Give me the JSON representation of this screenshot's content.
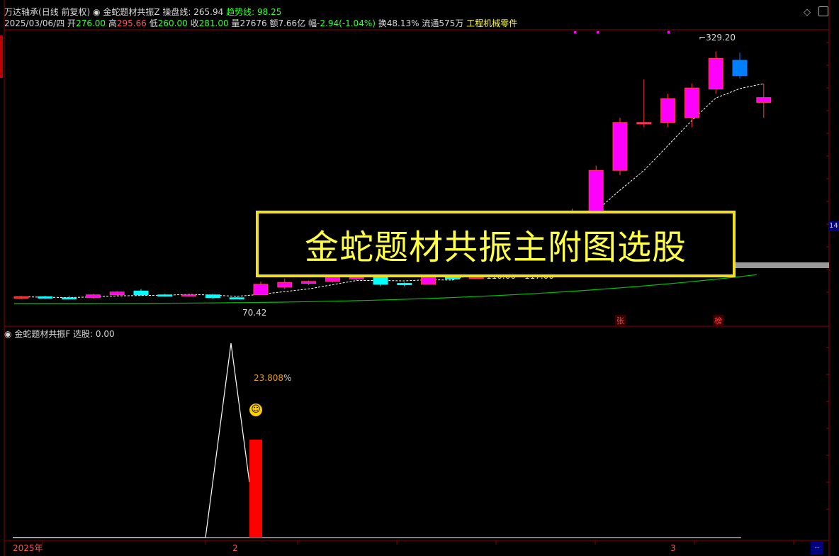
{
  "header": {
    "stock_name": "万达轴承",
    "period": "(日线 前复权)",
    "indicator_name": "金蛇题材共振Z",
    "line1_label": "操盘线:",
    "line1_value": "265.94",
    "line2_label": "趋势线:",
    "line2_value": "98.25"
  },
  "quote": {
    "date": "2025/03/06/四",
    "open_label": "开",
    "open": "276.00",
    "high_label": "高",
    "high": "295.66",
    "low_label": "低",
    "low": "260.00",
    "close_label": "收",
    "close": "281.00",
    "volume_label": "量",
    "volume": "27676",
    "amount_label": "额",
    "amount": "7.66亿",
    "change_label": "幅",
    "change": "-2.94(-1.04%)",
    "turnover_label": "换",
    "turnover": "48.13%",
    "float_label": "流通",
    "float": "575万",
    "sector": "工程机械零件"
  },
  "caption": "金蛇题材共振主附图选股",
  "annotations": {
    "max_price": "329.20",
    "min_price": "70.42",
    "range_label": "110.00 - 117.00",
    "tag_zhang": "张",
    "tag_bang": "榜",
    "right_edge_value": "14"
  },
  "sub_panel": {
    "indicator_name": "金蛇题材共振F",
    "label": "选股:",
    "value": "0.00",
    "annotation_value": "23.808",
    "annotation_mark": "%"
  },
  "x_axis": {
    "labels": [
      "2025年",
      "2",
      "3"
    ]
  },
  "colors": {
    "up_candle": "#ff00ff",
    "down_candle": "#00ffff",
    "down_candle_alt": "#0080ff",
    "ma_line": "#ffffff",
    "trend_line": "#00c000",
    "signal_bar": "#ff0000",
    "grid": "#8b0000",
    "caption_border": "#f0e020"
  },
  "chart_data": {
    "type": "candlestick",
    "title": "",
    "candles": [
      {
        "o": 72,
        "h": 74,
        "l": 70.42,
        "c": 73
      },
      {
        "o": 73,
        "h": 74,
        "l": 71,
        "c": 72
      },
      {
        "o": 72,
        "h": 74,
        "l": 70.5,
        "c": 71.5
      },
      {
        "o": 72,
        "h": 76,
        "l": 71,
        "c": 75
      },
      {
        "o": 75,
        "h": 79,
        "l": 74,
        "c": 78
      },
      {
        "o": 79,
        "h": 81,
        "l": 74,
        "c": 75
      },
      {
        "o": 75,
        "h": 76,
        "l": 73,
        "c": 74
      },
      {
        "o": 74,
        "h": 76,
        "l": 73,
        "c": 75
      },
      {
        "o": 75,
        "h": 76,
        "l": 71,
        "c": 72
      },
      {
        "o": 72,
        "h": 73,
        "l": 70.42,
        "c": 71
      },
      {
        "o": 75,
        "h": 89,
        "l": 75,
        "c": 86
      },
      {
        "o": 83,
        "h": 92,
        "l": 81,
        "c": 88
      },
      {
        "o": 87,
        "h": 90,
        "l": 85,
        "c": 89
      },
      {
        "o": 89,
        "h": 96,
        "l": 88,
        "c": 94
      },
      {
        "o": 92,
        "h": 94,
        "l": 90,
        "c": 93
      },
      {
        "o": 94,
        "h": 95,
        "l": 84,
        "c": 86
      },
      {
        "o": 87,
        "h": 88,
        "l": 84,
        "c": 86
      },
      {
        "o": 86,
        "h": 98,
        "l": 86,
        "c": 95
      },
      {
        "o": 93,
        "h": 96,
        "l": 90,
        "c": 92
      },
      {
        "o": 92,
        "h": 130,
        "l": 92,
        "c": 128
      },
      {
        "o": 128,
        "h": 150,
        "l": 120,
        "c": 145
      },
      {
        "o": 152,
        "h": 158,
        "l": 150,
        "c": 152
      },
      {
        "o": 152,
        "h": 155,
        "l": 140,
        "c": 150
      },
      {
        "o": 150,
        "h": 165,
        "l": 140,
        "c": 160
      },
      {
        "o": 160,
        "h": 210,
        "l": 155,
        "c": 205
      },
      {
        "o": 205,
        "h": 260,
        "l": 200,
        "c": 255
      },
      {
        "o": 255,
        "h": 300,
        "l": 250,
        "c": 255
      },
      {
        "o": 255,
        "h": 285,
        "l": 250,
        "c": 280
      },
      {
        "o": 260,
        "h": 295.66,
        "l": 250,
        "c": 291
      },
      {
        "o": 290,
        "h": 329.2,
        "l": 285,
        "c": 322
      },
      {
        "o": 320,
        "h": 328,
        "l": 301,
        "c": 304
      },
      {
        "o": 276,
        "h": 295.66,
        "l": 260,
        "c": 281
      }
    ],
    "sub_panel_series": {
      "name": "选股",
      "line": [
        0,
        0,
        0,
        0,
        0,
        0,
        0,
        0,
        0,
        0,
        0,
        0,
        0,
        0,
        0,
        0,
        0,
        0,
        0,
        0,
        0,
        0,
        0,
        0,
        0,
        100,
        20,
        0,
        0,
        0,
        0,
        0
      ],
      "signal_bar_value": 40
    },
    "x_tick_labels": [
      "2025年",
      "2",
      "3"
    ],
    "ylim": [
      60,
      340
    ]
  }
}
